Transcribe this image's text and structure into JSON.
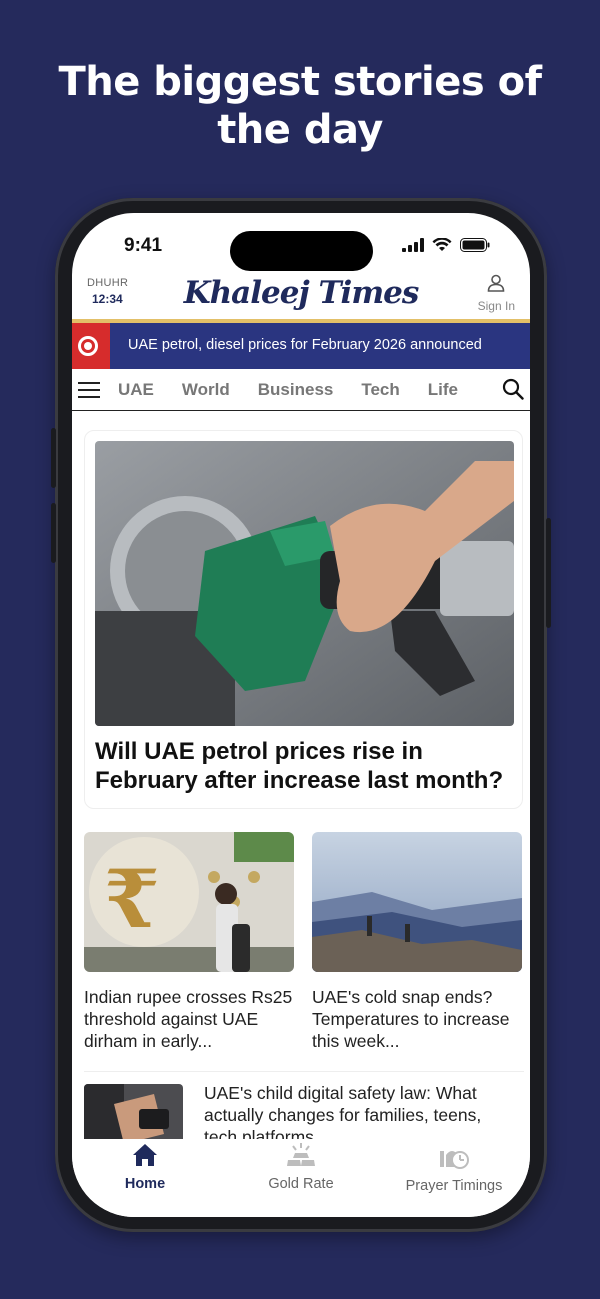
{
  "promo": {
    "headline_line1": "The biggest stories of",
    "headline_line2": "the day"
  },
  "status_bar": {
    "time": "9:41"
  },
  "header": {
    "prayer_name": "DHUHR",
    "prayer_time": "12:34",
    "logo_text": "Khaleej Times",
    "signin_label": "Sign In"
  },
  "breaking": {
    "text": "UAE petrol, diesel prices for February 2026 announced"
  },
  "nav": {
    "items": [
      {
        "label": "UAE"
      },
      {
        "label": "World"
      },
      {
        "label": "Business"
      },
      {
        "label": "Tech"
      },
      {
        "label": "Life"
      }
    ]
  },
  "feed": {
    "main": {
      "title": "Will UAE petrol prices rise in February after increase last month?"
    },
    "left": {
      "title": "Indian rupee crosses Rs25 threshold against UAE dirham in early..."
    },
    "right": {
      "title": "UAE's cold snap ends? Temperatures to increase this week..."
    },
    "row": {
      "title": "UAE's child digital safety law: What actually changes for families, teens, tech platforms"
    }
  },
  "tabbar": {
    "tabs": [
      {
        "label": "Home",
        "icon": "home-icon"
      },
      {
        "label": "Gold Rate",
        "icon": "gold-bars-icon"
      },
      {
        "label": "Prayer Timings",
        "icon": "prayer-clock-icon"
      }
    ]
  },
  "colors": {
    "background": "#252a5c",
    "brand_navy": "#1f2a5c",
    "breaking_bar": "#2a3580",
    "breaking_badge": "#d62c2c",
    "gold_accent": "#e3c068"
  }
}
